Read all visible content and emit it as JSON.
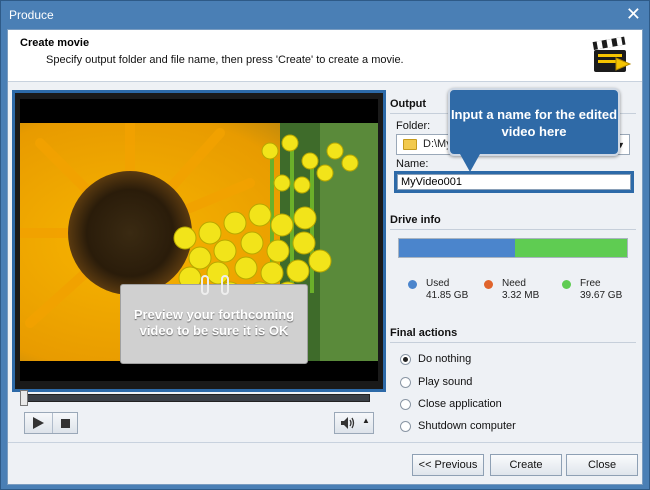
{
  "window": {
    "title": "Produce"
  },
  "header": {
    "title": "Create movie",
    "subtitle": "Specify output folder and file name, then press 'Create' to create a movie."
  },
  "preview": {
    "callout": "Preview your forthcoming video to be sure it is OK"
  },
  "output": {
    "section_title": "Output",
    "folder_label": "Folder:",
    "folder_value": "D:\\My V",
    "name_label": "Name:",
    "name_value": "MyVideo001",
    "callout": "Input a name for the edited video here"
  },
  "drive_info": {
    "section_title": "Drive info",
    "used_fraction": 0.51,
    "need_fraction": 0.0,
    "colors": {
      "used": "#4b85cc",
      "need": "#e0642c",
      "free": "#5fcc52"
    },
    "legend": [
      {
        "label": "Used",
        "value": "41.85 GB",
        "color": "#4b85cc"
      },
      {
        "label": "Need",
        "value": "3.32 MB",
        "color": "#e0642c"
      },
      {
        "label": "Free",
        "value": "39.67 GB",
        "color": "#5fcc52"
      }
    ]
  },
  "final_actions": {
    "section_title": "Final actions",
    "options": [
      {
        "label": "Do nothing",
        "checked": true
      },
      {
        "label": "Play sound",
        "checked": false
      },
      {
        "label": "Close application",
        "checked": false
      },
      {
        "label": "Shutdown computer",
        "checked": false
      }
    ]
  },
  "footer": {
    "previous_label": "<< Previous",
    "create_label": "Create",
    "close_label": "Close"
  },
  "icons": [
    "close-icon",
    "clapperboard-icon",
    "play-icon",
    "stop-icon",
    "volume-icon",
    "volume-dropdown-icon",
    "folder-icon",
    "chevron-down-icon"
  ]
}
